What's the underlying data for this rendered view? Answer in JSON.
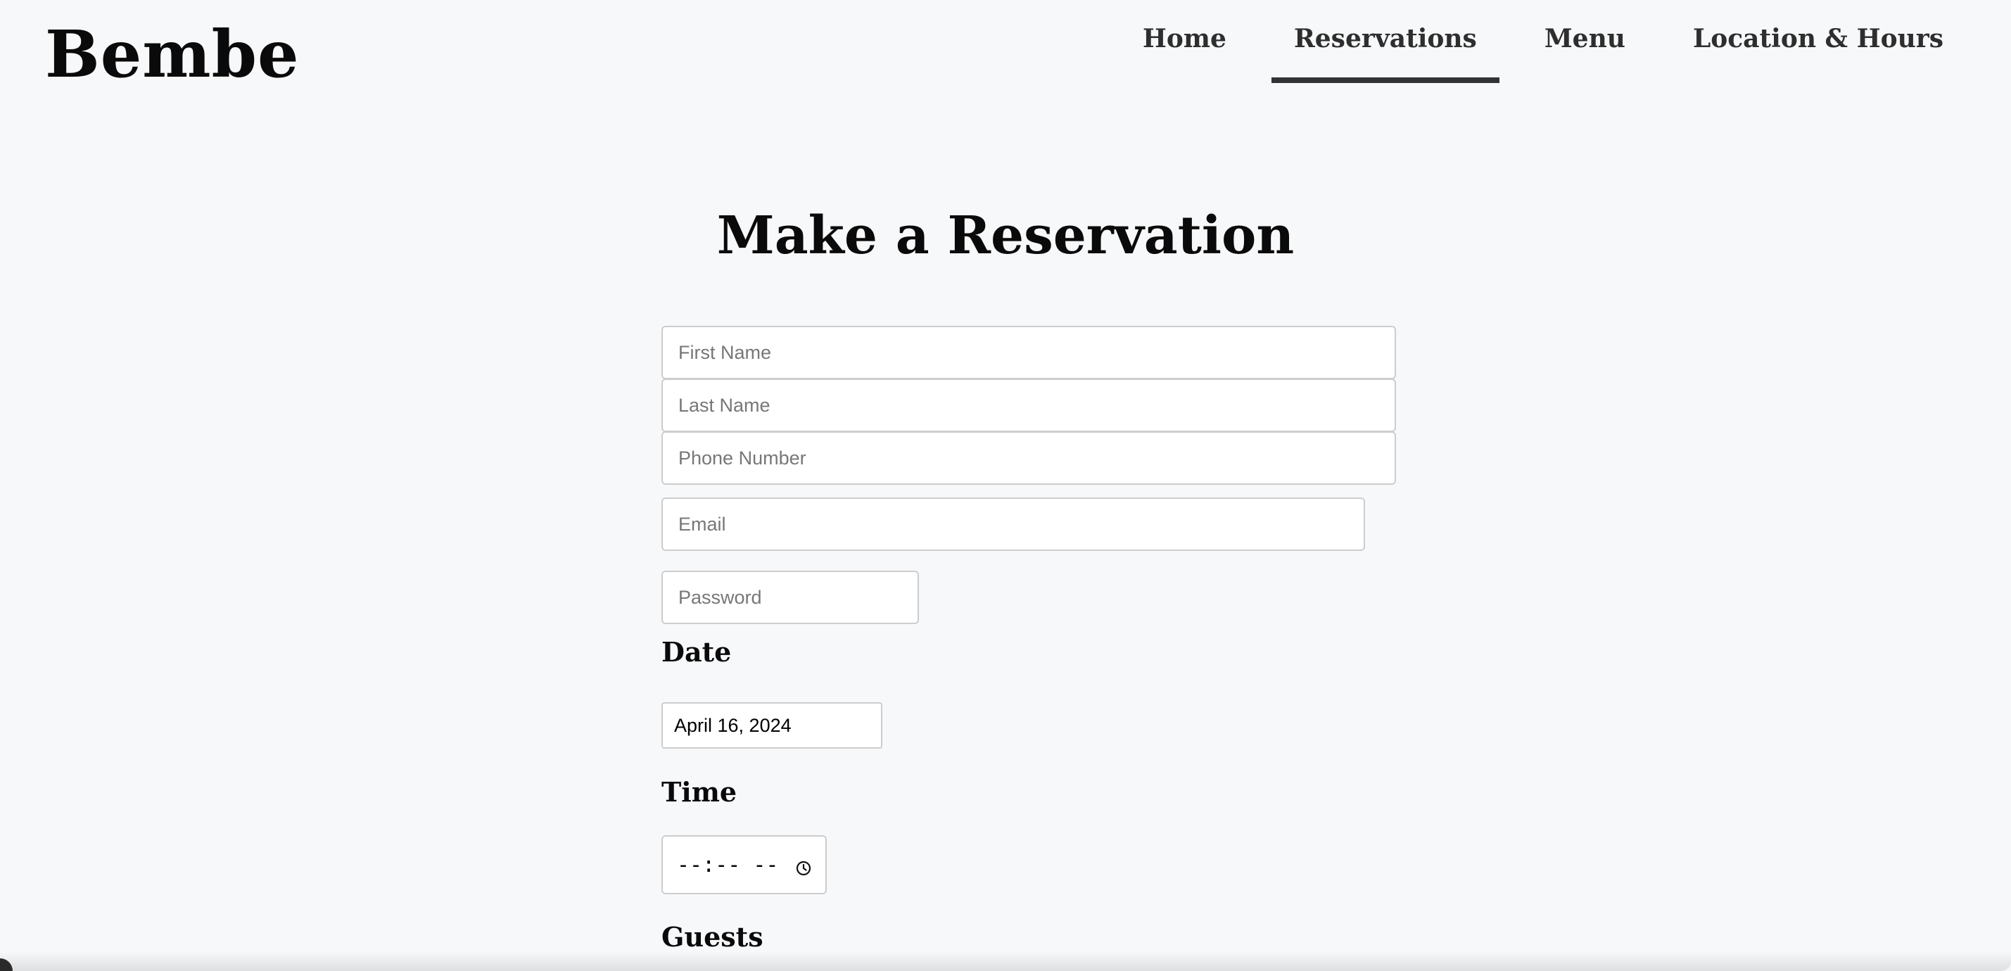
{
  "brand": {
    "name": "Bembe"
  },
  "nav": {
    "items": [
      {
        "label": "Home"
      },
      {
        "label": "Reservations"
      },
      {
        "label": "Menu"
      },
      {
        "label": "Location & Hours"
      }
    ],
    "active": "Reservations"
  },
  "page": {
    "title": "Make a Reservation"
  },
  "form": {
    "first_name": {
      "placeholder": "First Name",
      "value": ""
    },
    "last_name": {
      "placeholder": "Last Name",
      "value": ""
    },
    "phone": {
      "placeholder": "Phone Number",
      "value": ""
    },
    "email": {
      "placeholder": "Email",
      "value": ""
    },
    "password": {
      "placeholder": "Password",
      "value": ""
    },
    "date": {
      "label": "Date",
      "value": "April 16, 2024"
    },
    "time": {
      "label": "Time",
      "value": "--:-- --",
      "icon": "clock-icon"
    },
    "guests": {
      "label": "Guests"
    }
  },
  "colors": {
    "background": "#f7f8fa",
    "nav_text": "#2e2e2e",
    "active_underline": "#333333",
    "field_border": "#cdcdcd"
  }
}
